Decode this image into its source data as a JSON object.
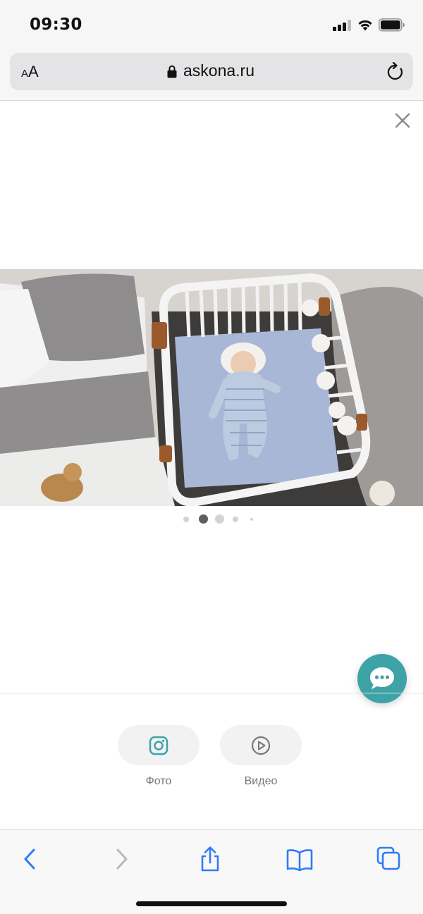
{
  "status_bar": {
    "time": "09:30"
  },
  "browser": {
    "text_size_small": "A",
    "text_size_large": "A",
    "url": "askona.ru"
  },
  "gallery": {
    "image_alt": "Baby lying in a white crib next to a bed",
    "slide_count": 5,
    "active_index": 1
  },
  "media": {
    "photo_label": "Фото",
    "video_label": "Видео"
  },
  "colors": {
    "accent": "#3ea3a6",
    "toolbar_blue": "#2f7cf6"
  },
  "icons": {
    "close": "close-icon",
    "chat": "chat-icon",
    "photo": "instagram-icon",
    "video": "play-icon"
  }
}
